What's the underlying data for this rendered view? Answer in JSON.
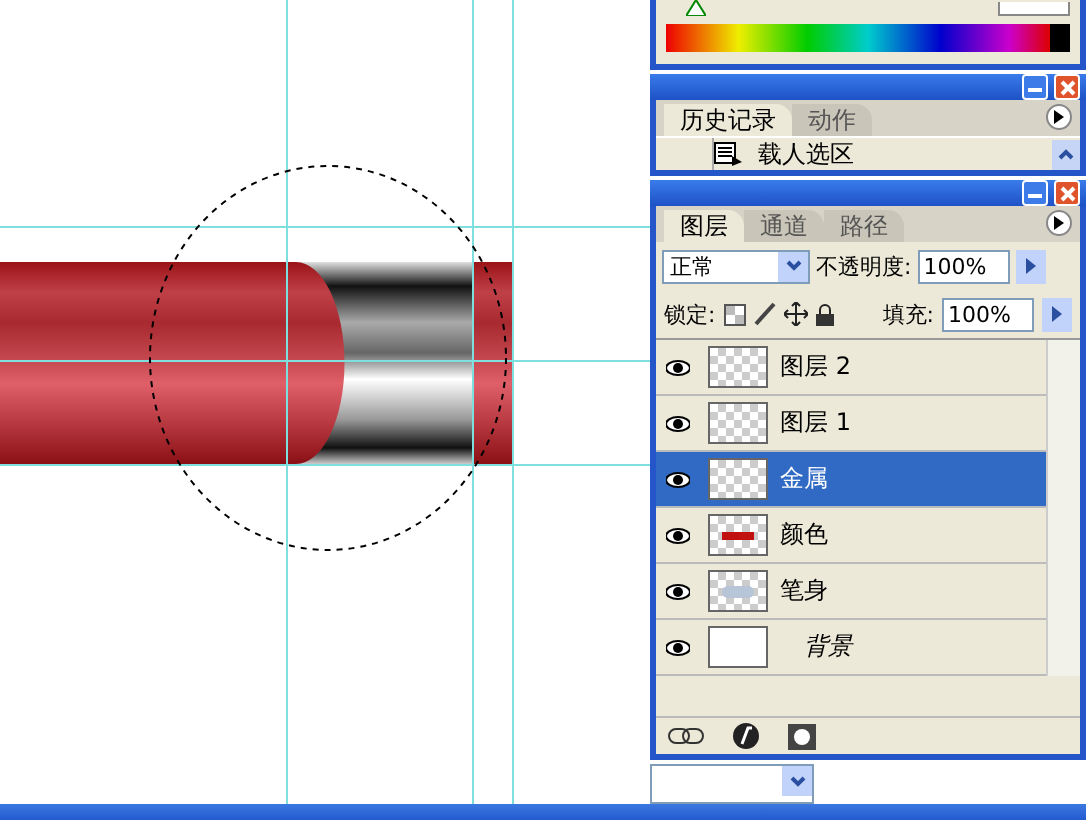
{
  "history_panel": {
    "tabs": [
      {
        "label": "历史记录",
        "selected": true
      },
      {
        "label": "动作",
        "selected": false
      }
    ],
    "items": [
      {
        "label": "载人选区"
      }
    ]
  },
  "layers_panel": {
    "tabs": [
      {
        "label": "图层",
        "selected": true
      },
      {
        "label": "通道",
        "selected": false
      },
      {
        "label": "路径",
        "selected": false
      }
    ],
    "blend_mode": "正常",
    "opacity_label": "不透明度:",
    "opacity": "100%",
    "lock_label": "锁定:",
    "fill_label": "填充:",
    "fill": "100%",
    "layers": [
      {
        "name": "图层 2",
        "visible": true,
        "selected": false,
        "kind": "transparent"
      },
      {
        "name": "图层 1",
        "visible": true,
        "selected": false,
        "kind": "transparent"
      },
      {
        "name": "金属",
        "visible": true,
        "selected": true,
        "kind": "transparent"
      },
      {
        "name": "颜色",
        "visible": true,
        "selected": false,
        "kind": "stroke"
      },
      {
        "name": "笔身",
        "visible": true,
        "selected": false,
        "kind": "shape"
      },
      {
        "name": "背景",
        "visible": true,
        "selected": false,
        "kind": "background"
      }
    ]
  }
}
